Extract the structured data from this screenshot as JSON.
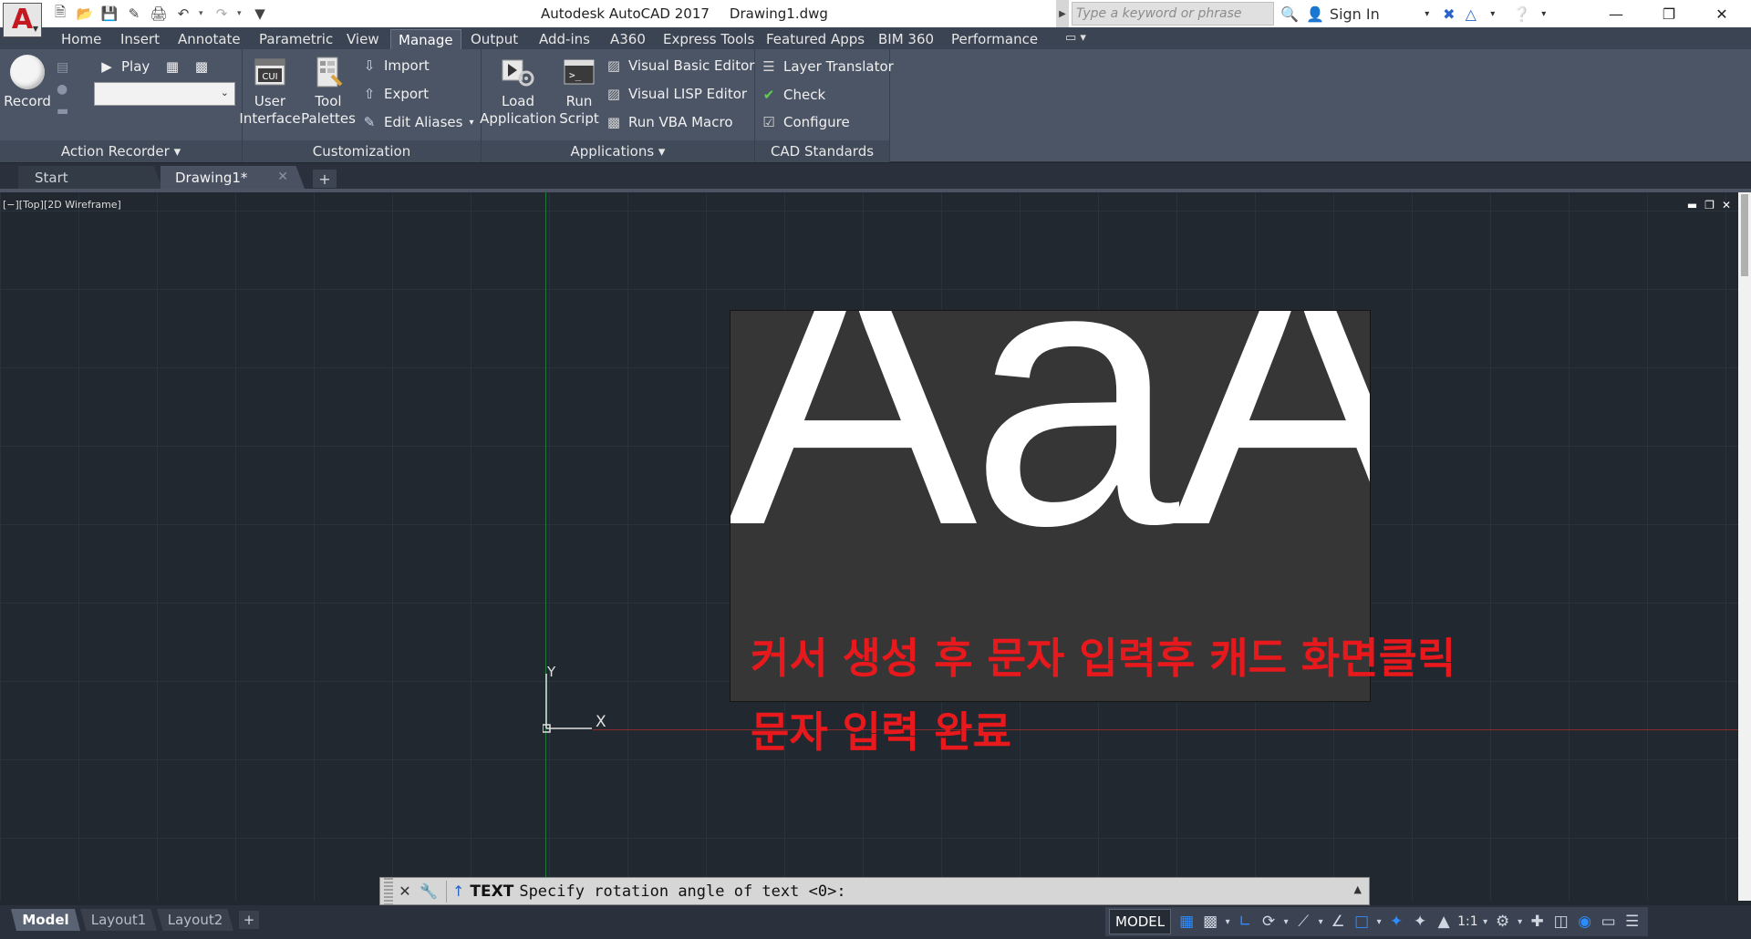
{
  "window": {
    "app_name": "Autodesk AutoCAD 2017",
    "file_name": "Drawing1.dwg",
    "app_logo": "A"
  },
  "search": {
    "placeholder": "Type a keyword or phrase"
  },
  "user": {
    "sign_in_label": "Sign In"
  },
  "ribbon_tabs": [
    {
      "label": "Home"
    },
    {
      "label": "Insert"
    },
    {
      "label": "Annotate"
    },
    {
      "label": "Parametric"
    },
    {
      "label": "View"
    },
    {
      "label": "Manage"
    },
    {
      "label": "Output"
    },
    {
      "label": "Add-ins"
    },
    {
      "label": "A360"
    },
    {
      "label": "Express Tools"
    },
    {
      "label": "Featured Apps"
    },
    {
      "label": "BIM 360"
    },
    {
      "label": "Performance"
    }
  ],
  "active_ribbon_tab": "Manage",
  "panels": {
    "action_recorder": {
      "title": "Action Recorder",
      "record_label": "Record",
      "play_label": "Play"
    },
    "customization": {
      "title": "Customization",
      "user_interface_label_1": "User",
      "user_interface_label_2": "Interface",
      "tool_palettes_label_1": "Tool",
      "tool_palettes_label_2": "Palettes",
      "import_label": "Import",
      "export_label": "Export",
      "edit_aliases_label": "Edit Aliases",
      "cui_icon_text": "CUI"
    },
    "applications": {
      "title": "Applications",
      "load_app_label_1": "Load",
      "load_app_label_2": "Application",
      "run_script_label_1": "Run",
      "run_script_label_2": "Script",
      "vba_editor_label": "Visual Basic Editor",
      "lisp_editor_label": "Visual LISP Editor",
      "run_vba_label": "Run VBA Macro"
    },
    "cad_standards": {
      "title": "CAD Standards",
      "layer_translator_label": "Layer Translator",
      "check_label": "Check",
      "configure_label": "Configure"
    }
  },
  "doc_tabs": [
    {
      "label": "Start"
    },
    {
      "label": "Drawing1*"
    }
  ],
  "viewport": {
    "label": "[−][Top][2D Wireframe]",
    "ucs_x": "X",
    "ucs_y": "Y"
  },
  "drawing_content": {
    "text_object": "AaA",
    "annotation_line_1": "커서 생성 후 문자 입력후 캐드 화면클릭",
    "annotation_line_2": "문자 입력 완료",
    "annotation_color": "#e8191c"
  },
  "command_line": {
    "command": "TEXT",
    "prompt": "Specify rotation angle of text <0>:"
  },
  "layout_tabs": [
    {
      "label": "Model"
    },
    {
      "label": "Layout1"
    },
    {
      "label": "Layout2"
    }
  ],
  "status_bar": {
    "model_label": "MODEL",
    "scale_label": "1:1"
  },
  "colors": {
    "accent_blue": "#2d8cff",
    "autocad_red": "#c41920",
    "canvas_bg": "#212830"
  }
}
